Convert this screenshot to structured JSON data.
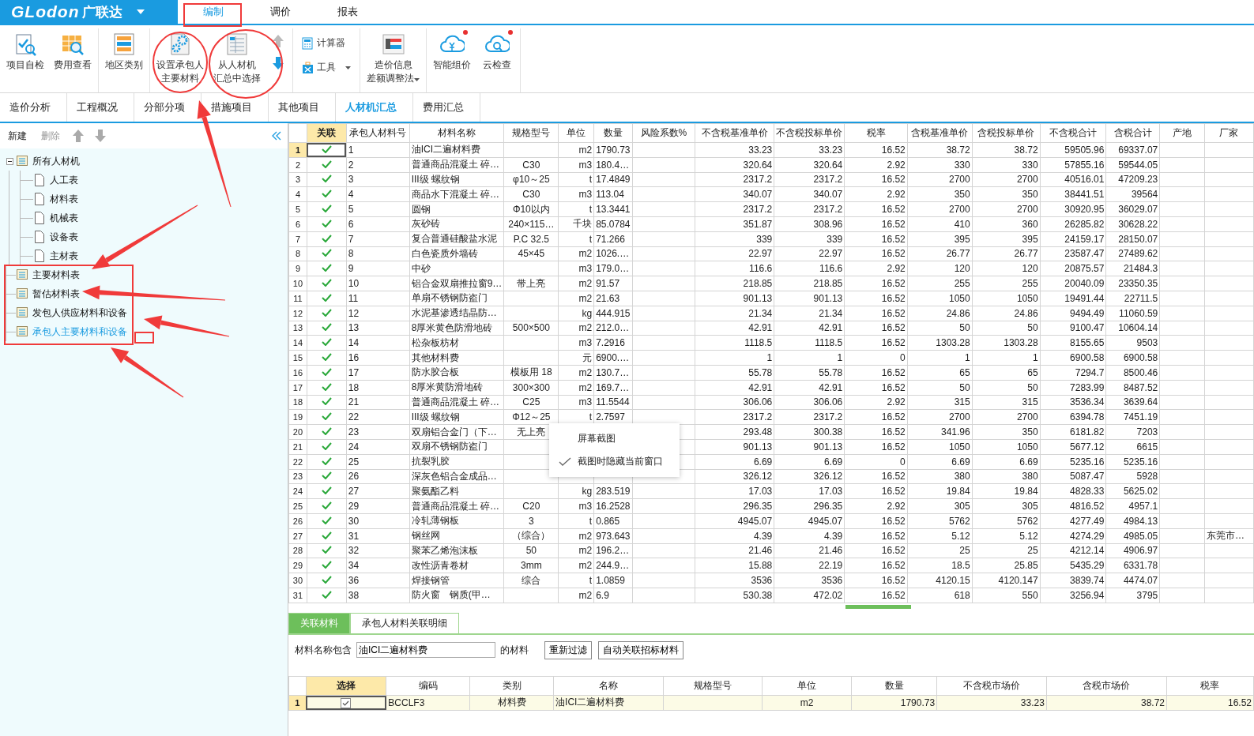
{
  "app": {
    "logo": "GLodon",
    "brand": "广联达",
    "menu_tabs": [
      {
        "label": "编制",
        "selected": true
      },
      {
        "label": "调价",
        "selected": false
      },
      {
        "label": "报表",
        "selected": false
      }
    ]
  },
  "ribbon": [
    {
      "items": [
        {
          "kind": "large",
          "lines": [
            "项目自检"
          ]
        },
        {
          "kind": "large",
          "lines": [
            "费用查看"
          ]
        }
      ]
    },
    {
      "items": [
        {
          "kind": "large",
          "lines": [
            "地区类别"
          ]
        }
      ]
    },
    {
      "items": [
        {
          "kind": "large",
          "lines": [
            "设置承包人",
            "主要材料"
          ]
        },
        {
          "kind": "large",
          "lines": [
            "从人材机",
            "汇总中选择"
          ]
        },
        {
          "kind": "arrows",
          "up_disabled": true,
          "down_disabled": false
        }
      ]
    },
    {
      "items": [
        {
          "kind": "small",
          "label": "计算器",
          "dropdown": false
        },
        {
          "kind": "small",
          "label": "工具",
          "dropdown": true
        }
      ]
    },
    {
      "items": [
        {
          "kind": "large",
          "lines": [
            "造价信息",
            "差额调整法"
          ],
          "dropdown": true
        }
      ]
    },
    {
      "items": [
        {
          "kind": "large",
          "lines": [
            "智能组价"
          ],
          "badge": true
        },
        {
          "kind": "large",
          "lines": [
            "云检查"
          ],
          "badge": true
        }
      ]
    }
  ],
  "view_tabs": [
    {
      "label": "造价分析",
      "selected": false
    },
    {
      "label": "工程概况",
      "selected": false
    },
    {
      "label": "分部分项",
      "selected": false
    },
    {
      "label": "措施项目",
      "selected": false
    },
    {
      "label": "其他项目",
      "selected": false
    },
    {
      "label": "人材机汇总",
      "selected": true
    },
    {
      "label": "费用汇总",
      "selected": false
    }
  ],
  "sidebar": {
    "toolbar": [
      {
        "label": "新建",
        "disabled": false
      },
      {
        "label": "删除",
        "disabled": true
      }
    ],
    "move_up_disabled": true,
    "move_down_disabled": true,
    "tree": [
      {
        "label": "所有人材机",
        "selected": false,
        "expanded": true,
        "children": [
          {
            "label": "人工表",
            "selected": false
          },
          {
            "label": "材料表",
            "selected": false
          },
          {
            "label": "机械表",
            "selected": false
          },
          {
            "label": "设备表",
            "selected": false
          },
          {
            "label": "主材表",
            "selected": false
          }
        ]
      },
      {
        "label": "主要材料表",
        "selected": false
      },
      {
        "label": "暂估材料表",
        "selected": false
      },
      {
        "label": "发包人供应材料和设备",
        "selected": false
      },
      {
        "label": "承包人主要材料和设备",
        "selected": true
      }
    ]
  },
  "table": {
    "link_column": {
      "label": "关联",
      "selected": true
    },
    "columns": [
      {
        "label": "承包人材料号",
        "selected": false
      },
      {
        "label": "材料名称",
        "selected": false
      },
      {
        "label": "规格型号",
        "selected": false
      },
      {
        "label": "单位",
        "selected": false
      },
      {
        "label": "数量",
        "selected": false
      },
      {
        "label": "风险系数%",
        "selected": false
      },
      {
        "label": "不含税基准单价",
        "selected": false
      },
      {
        "label": "不含税投标单价",
        "selected": false
      },
      {
        "label": "税率",
        "selected": false
      },
      {
        "label": "含税基准单价",
        "selected": false
      },
      {
        "label": "含税投标单价",
        "selected": false
      },
      {
        "label": "不含税合计",
        "selected": false
      },
      {
        "label": "含税合计",
        "selected": false
      },
      {
        "label": "产地",
        "selected": false
      },
      {
        "label": "厂家",
        "selected": false
      }
    ],
    "rows": [
      {
        "num": "1",
        "linked": true,
        "selected": true,
        "cells": [
          "1",
          "油ICI二遍材料费",
          null,
          "m2",
          "1790.73",
          null,
          "33.23",
          "33.23",
          "16.52",
          "38.72",
          "38.72",
          "59505.96",
          "69337.07",
          null,
          null
        ]
      },
      {
        "num": "2",
        "linked": true,
        "selected": false,
        "cells": [
          "2",
          "普通商品混凝土 碎…",
          "C30",
          "m3",
          "180.4…",
          null,
          "320.64",
          "320.64",
          "2.92",
          "330",
          "330",
          "57855.16",
          "59544.05",
          null,
          null
        ]
      },
      {
        "num": "3",
        "linked": true,
        "selected": false,
        "cells": [
          "3",
          "III级 螺纹钢",
          "φ10～25",
          "t",
          "17.4849",
          null,
          "2317.2",
          "2317.2",
          "16.52",
          "2700",
          "2700",
          "40516.01",
          "47209.23",
          null,
          null
        ]
      },
      {
        "num": "4",
        "linked": true,
        "selected": false,
        "cells": [
          "4",
          "商品水下混凝土 碎…",
          "C30",
          "m3",
          "113.04",
          null,
          "340.07",
          "340.07",
          "2.92",
          "350",
          "350",
          "38441.51",
          "39564",
          null,
          null
        ]
      },
      {
        "num": "5",
        "linked": true,
        "selected": false,
        "cells": [
          "5",
          "圆钢",
          "Φ10以内",
          "t",
          "13.3441",
          null,
          "2317.2",
          "2317.2",
          "16.52",
          "2700",
          "2700",
          "30920.95",
          "36029.07",
          null,
          null
        ]
      },
      {
        "num": "6",
        "linked": true,
        "selected": false,
        "cells": [
          "6",
          "灰砂砖",
          "240×115…",
          "千块",
          "85.0784",
          null,
          "351.87",
          "308.96",
          "16.52",
          "410",
          "360",
          "26285.82",
          "30628.22",
          null,
          null
        ]
      },
      {
        "num": "7",
        "linked": true,
        "selected": false,
        "cells": [
          "7",
          "复合普通硅酸盐水泥",
          "P.C 32.5",
          "t",
          "71.266",
          null,
          "339",
          "339",
          "16.52",
          "395",
          "395",
          "24159.17",
          "28150.07",
          null,
          null
        ]
      },
      {
        "num": "8",
        "linked": true,
        "selected": false,
        "cells": [
          "8",
          "白色瓷质外墙砖",
          "45×45",
          "m2",
          "1026.…",
          null,
          "22.97",
          "22.97",
          "16.52",
          "26.77",
          "26.77",
          "23587.47",
          "27489.62",
          null,
          null
        ]
      },
      {
        "num": "9",
        "linked": true,
        "selected": false,
        "cells": [
          "9",
          "中砂",
          null,
          "m3",
          "179.0…",
          null,
          "116.6",
          "116.6",
          "2.92",
          "120",
          "120",
          "20875.57",
          "21484.3",
          null,
          null
        ]
      },
      {
        "num": "10",
        "linked": true,
        "selected": false,
        "cells": [
          "10",
          "铝合金双扇推拉窗9…",
          "带上亮",
          "m2",
          "91.57",
          null,
          "218.85",
          "218.85",
          "16.52",
          "255",
          "255",
          "20040.09",
          "23350.35",
          null,
          null
        ]
      },
      {
        "num": "11",
        "linked": true,
        "selected": false,
        "cells": [
          "11",
          "单扇不锈钢防盗门",
          null,
          "m2",
          "21.63",
          null,
          "901.13",
          "901.13",
          "16.52",
          "1050",
          "1050",
          "19491.44",
          "22711.5",
          null,
          null
        ]
      },
      {
        "num": "12",
        "linked": true,
        "selected": false,
        "cells": [
          "12",
          "水泥基渗透结晶防…",
          null,
          "kg",
          "444.915",
          null,
          "21.34",
          "21.34",
          "16.52",
          "24.86",
          "24.86",
          "9494.49",
          "11060.59",
          null,
          null
        ]
      },
      {
        "num": "13",
        "linked": true,
        "selected": false,
        "cells": [
          "13",
          "8厚米黄色防滑地砖",
          "500×500",
          "m2",
          "212.0…",
          null,
          "42.91",
          "42.91",
          "16.52",
          "50",
          "50",
          "9100.47",
          "10604.14",
          null,
          null
        ]
      },
      {
        "num": "14",
        "linked": true,
        "selected": false,
        "cells": [
          "14",
          "松杂板枋材",
          null,
          "m3",
          "7.2916",
          null,
          "1118.5",
          "1118.5",
          "16.52",
          "1303.28",
          "1303.28",
          "8155.65",
          "9503",
          null,
          null
        ]
      },
      {
        "num": "15",
        "linked": true,
        "selected": false,
        "cells": [
          "16",
          "其他材料费",
          null,
          "元",
          "6900.…",
          null,
          "1",
          "1",
          "0",
          "1",
          "1",
          "6900.58",
          "6900.58",
          null,
          null
        ]
      },
      {
        "num": "16",
        "linked": true,
        "selected": false,
        "cells": [
          "17",
          "防水胶合板",
          "模板用 18",
          "m2",
          "130.7…",
          null,
          "55.78",
          "55.78",
          "16.52",
          "65",
          "65",
          "7294.7",
          "8500.46",
          null,
          null
        ]
      },
      {
        "num": "17",
        "linked": true,
        "selected": false,
        "cells": [
          "18",
          "8厚米黄防滑地砖",
          "300×300",
          "m2",
          "169.7…",
          null,
          "42.91",
          "42.91",
          "16.52",
          "50",
          "50",
          "7283.99",
          "8487.52",
          null,
          null
        ]
      },
      {
        "num": "18",
        "linked": true,
        "selected": false,
        "cells": [
          "21",
          "普通商品混凝土 碎…",
          "C25",
          "m3",
          "11.5544",
          null,
          "306.06",
          "306.06",
          "2.92",
          "315",
          "315",
          "3536.34",
          "3639.64",
          null,
          null
        ]
      },
      {
        "num": "19",
        "linked": true,
        "selected": false,
        "cells": [
          "22",
          "III级 螺纹钢",
          "Φ12～25",
          "t",
          "2.7597",
          null,
          "2317.2",
          "2317.2",
          "16.52",
          "2700",
          "2700",
          "6394.78",
          "7451.19",
          null,
          null
        ]
      },
      {
        "num": "20",
        "linked": true,
        "selected": false,
        "cells": [
          "23",
          "双扇铝合金门（下…",
          "无上亮",
          null,
          null,
          null,
          "293.48",
          "300.38",
          "16.52",
          "341.96",
          "350",
          "6181.82",
          "7203",
          null,
          null
        ]
      },
      {
        "num": "21",
        "linked": true,
        "selected": false,
        "cells": [
          "24",
          "双扇不锈钢防盗门",
          null,
          null,
          null,
          null,
          "901.13",
          "901.13",
          "16.52",
          "1050",
          "1050",
          "5677.12",
          "6615",
          null,
          null
        ]
      },
      {
        "num": "22",
        "linked": true,
        "selected": false,
        "cells": [
          "25",
          "抗裂乳胶",
          null,
          null,
          null,
          null,
          "6.69",
          "6.69",
          "0",
          "6.69",
          "6.69",
          "5235.16",
          "5235.16",
          null,
          null
        ]
      },
      {
        "num": "23",
        "linked": true,
        "selected": false,
        "cells": [
          "26",
          "深灰色铝合金成品…",
          null,
          null,
          null,
          null,
          "326.12",
          "326.12",
          "16.52",
          "380",
          "380",
          "5087.47",
          "5928",
          null,
          null
        ]
      },
      {
        "num": "24",
        "linked": true,
        "selected": false,
        "cells": [
          "27",
          "聚氨酯乙料",
          null,
          "kg",
          "283.519",
          null,
          "17.03",
          "17.03",
          "16.52",
          "19.84",
          "19.84",
          "4828.33",
          "5625.02",
          null,
          null
        ]
      },
      {
        "num": "25",
        "linked": true,
        "selected": false,
        "cells": [
          "29",
          "普通商品混凝土 碎…",
          "C20",
          "m3",
          "16.2528",
          null,
          "296.35",
          "296.35",
          "2.92",
          "305",
          "305",
          "4816.52",
          "4957.1",
          null,
          null
        ]
      },
      {
        "num": "26",
        "linked": true,
        "selected": false,
        "cells": [
          "30",
          "冷轧薄钢板",
          "3",
          "t",
          "0.865",
          null,
          "4945.07",
          "4945.07",
          "16.52",
          "5762",
          "5762",
          "4277.49",
          "4984.13",
          null,
          null
        ]
      },
      {
        "num": "27",
        "linked": true,
        "selected": false,
        "cells": [
          "31",
          "钢丝网",
          "（综合）",
          "m2",
          "973.643",
          null,
          "4.39",
          "4.39",
          "16.52",
          "5.12",
          "5.12",
          "4274.29",
          "4985.05",
          null,
          "东莞市…"
        ]
      },
      {
        "num": "28",
        "linked": true,
        "selected": false,
        "cells": [
          "32",
          "聚苯乙烯泡沫板",
          "50",
          "m2",
          "196.2…",
          null,
          "21.46",
          "21.46",
          "16.52",
          "25",
          "25",
          "4212.14",
          "4906.97",
          null,
          null
        ]
      },
      {
        "num": "29",
        "linked": true,
        "selected": false,
        "cells": [
          "34",
          "改性沥青卷材",
          "3mm",
          "m2",
          "244.9…",
          null,
          "15.88",
          "22.19",
          "16.52",
          "18.5",
          "25.85",
          "5435.29",
          "6331.78",
          null,
          null
        ]
      },
      {
        "num": "30",
        "linked": true,
        "selected": false,
        "cells": [
          "36",
          "焊接钢管",
          "综合",
          "t",
          "1.0859",
          null,
          "3536",
          "3536",
          "16.52",
          "4120.15",
          "4120.147",
          "3839.74",
          "4474.07",
          null,
          null
        ]
      },
      {
        "num": "31",
        "linked": true,
        "selected": false,
        "cells": [
          "38",
          "防火窗　钢质(甲…",
          null,
          "m2",
          "6.9",
          null,
          "530.38",
          "472.02",
          "16.52",
          "618",
          "550",
          "3256.94",
          "3795",
          null,
          null
        ]
      }
    ]
  },
  "context_menu": {
    "items": [
      {
        "label": "屏幕截图",
        "checked": false
      },
      {
        "label": "截图时隐藏当前窗口",
        "checked": true
      }
    ]
  },
  "detail": {
    "tabs": [
      {
        "label": "关联材料",
        "selected": true
      },
      {
        "label": "承包人材料关联明细",
        "selected": false
      }
    ],
    "filter": {
      "label": "材料名称包含",
      "value": "油ICI二遍材料费",
      "suffix": "的材料",
      "buttons": [
        "重新过滤",
        "自动关联招标材料"
      ]
    },
    "table": {
      "columns": [
        {
          "label": "选择",
          "selected": true
        },
        {
          "label": "编码",
          "selected": false
        },
        {
          "label": "类别",
          "selected": false
        },
        {
          "label": "名称",
          "selected": false
        },
        {
          "label": "规格型号",
          "selected": false
        },
        {
          "label": "单位",
          "selected": false
        },
        {
          "label": "数量",
          "selected": false
        },
        {
          "label": "不含税市场价",
          "selected": false
        },
        {
          "label": "含税市场价",
          "selected": false
        },
        {
          "label": "税率",
          "selected": false
        }
      ],
      "rows": [
        {
          "num": "1",
          "checked": true,
          "selected": true,
          "cells": [
            "",
            "BCCLF3",
            "材料费",
            "油ICI二遍材料费",
            null,
            "m2",
            "1790.73",
            "33.23",
            "38.72",
            "16.52"
          ]
        }
      ]
    }
  }
}
